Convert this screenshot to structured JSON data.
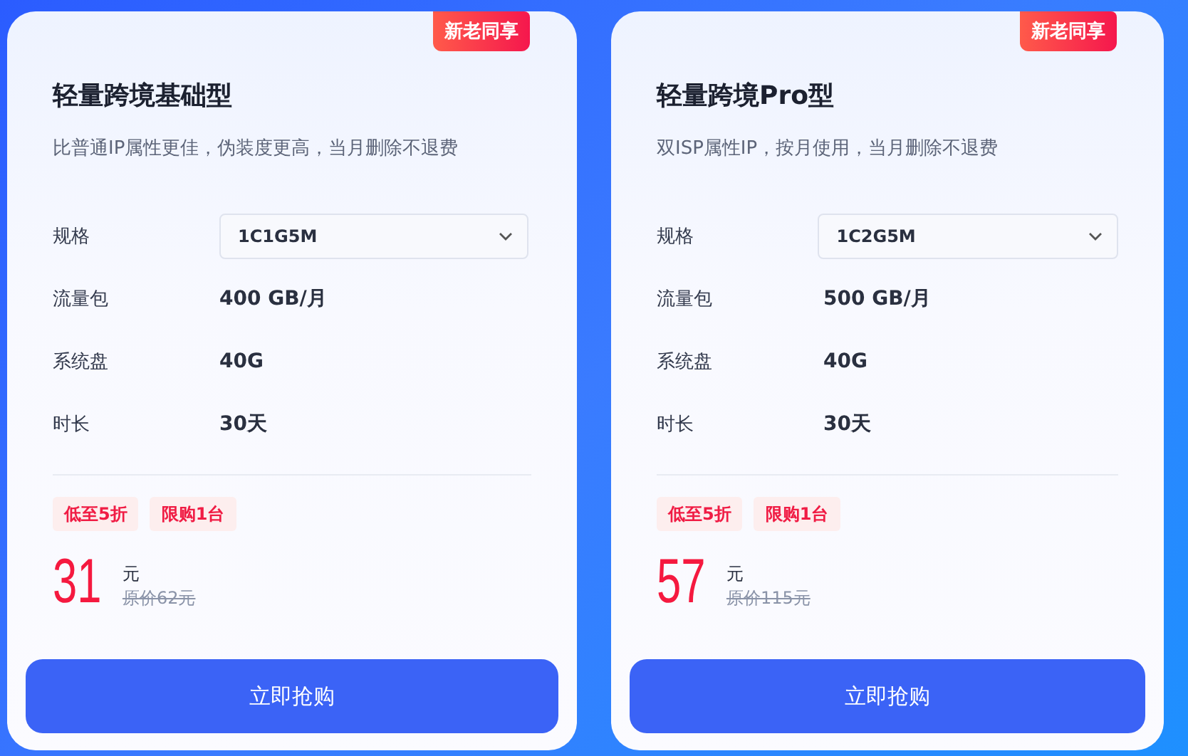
{
  "cards": [
    {
      "badge": "新老同享",
      "title": "轻量跨境基础型",
      "description": "比普通IP属性更佳，伪装度更高，当月删除不退费",
      "specs": [
        {
          "kind": "select",
          "label": "规格",
          "value": "1C1G5M"
        },
        {
          "kind": "text",
          "label": "流量包",
          "value": "400 GB/月"
        },
        {
          "kind": "text",
          "label": "系统盘",
          "value": "40G"
        },
        {
          "kind": "text",
          "label": "时长",
          "value": "30天"
        }
      ],
      "tags": [
        "低至5折",
        "限购1台"
      ],
      "price": "31",
      "unit": "元",
      "original_price": "原价62元",
      "button": "立即抢购"
    },
    {
      "badge": "新老同享",
      "title": "轻量跨境Pro型",
      "description": "双ISP属性IP，按月使用，当月删除不退费",
      "specs": [
        {
          "kind": "select",
          "label": "规格",
          "value": "1C2G5M"
        },
        {
          "kind": "text",
          "label": "流量包",
          "value": "500 GB/月"
        },
        {
          "kind": "text",
          "label": "系统盘",
          "value": "40G"
        },
        {
          "kind": "text",
          "label": "时长",
          "value": "30天"
        }
      ],
      "tags": [
        "低至5折",
        "限购1台"
      ],
      "price": "57",
      "unit": "元",
      "original_price": "原价115元",
      "button": "立即抢购"
    }
  ]
}
